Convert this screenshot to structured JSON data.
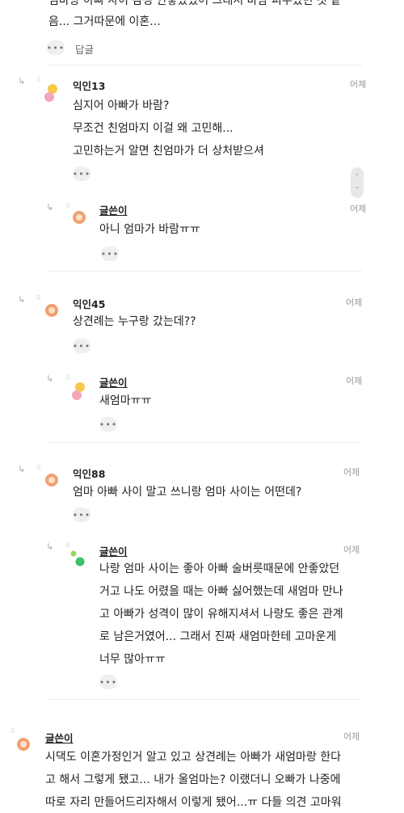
{
  "top": {
    "lines": [
      "엄마랑 아빠 사이 감정 안좋았었어 그래서 바람 피우셨던 것 같",
      "음... 그거따문에 이혼..."
    ],
    "reply_label": "답글"
  },
  "c1": {
    "name": "익인13",
    "time": "어제",
    "lines": [
      "심지어 아빠가 바람?",
      "무조건 친엄마지 이걸 왜 고민해...",
      "고민하는거 알면 친엄마가 더 상처받으셔"
    ]
  },
  "r1": {
    "name": "글쓴이",
    "time": "어제",
    "lines": [
      "아니 엄마가 바람ㅠㅠ"
    ]
  },
  "c2": {
    "name": "익인45",
    "time": "어제",
    "lines": [
      "상견례는 누구랑 갔는데??"
    ]
  },
  "r2": {
    "name": "글쓴이",
    "time": "어제",
    "lines": [
      "새엄마ㅠㅠ"
    ]
  },
  "c3": {
    "name": "익인88",
    "time": "어제",
    "lines": [
      "엄마 아빠 사이 말고 쓰니랑 엄마 사이는 어떤데?"
    ]
  },
  "r3": {
    "name": "글쓴이",
    "time": "어제",
    "lines": [
      "나랑 엄마 사이는 좋아 아빠 술버릇때문에 안좋았던",
      "거고 나도 어렸을 때는 아빠 싫어했는데 새엄마 만나",
      "고 아빠가 성격이 많이 유해지셔서 나랑도 좋은 관계",
      "로 남은거였어... 그래서 진짜 새엄마한테 고마운게",
      "너무 많아ㅠㅠ"
    ]
  },
  "c4": {
    "name": "글쓴이",
    "time": "어제",
    "lines": [
      "시댁도 이혼가정인거 알고 있고 상견례는 아빠가 새엄마랑 한다",
      "고 해서 그렇게 됐고... 내가 울엄마는? 이랬더니 오빠가 나중에",
      "따로 자리 만들어드리자해서 이렇게 됐어...ㅠ 다들 의견 고마워"
    ]
  },
  "more_label": "•••",
  "icons": {
    "reply_arrow": "↳",
    "pin": "▯"
  },
  "colors": {
    "avatar_orange": "#f0a070",
    "avatar_pink": "#f4a6b8",
    "avatar_yellow": "#f7c84a",
    "avatar_green": "#3cc36b"
  }
}
